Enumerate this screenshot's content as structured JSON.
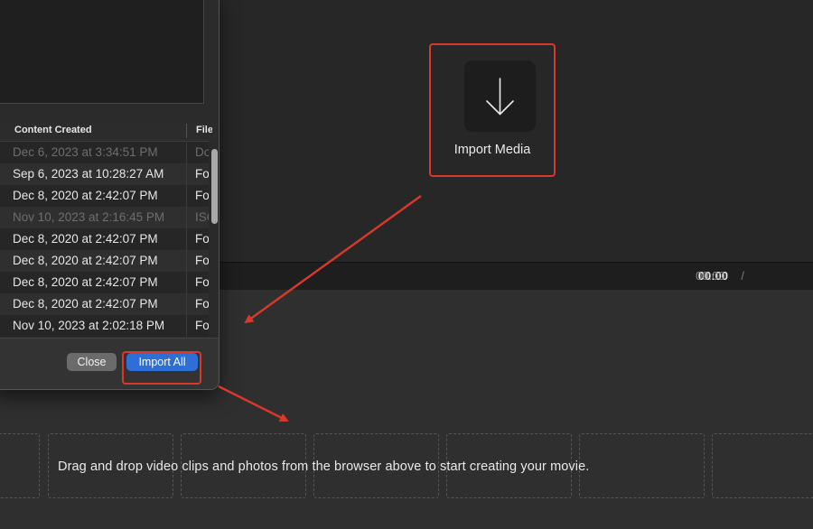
{
  "import_media": {
    "label": "Import Media"
  },
  "transport": {
    "current_time": "00:00",
    "separator": "/",
    "total_time": "00:00"
  },
  "timeline": {
    "hint": "Drag and drop video clips and photos from the browser above to start creating your movie."
  },
  "import_dialog": {
    "columns": [
      "Content Created",
      "File"
    ],
    "rows": [
      {
        "date": "Dec 6, 2023 at 3:34:51 PM",
        "file": "Do",
        "dimmed": true
      },
      {
        "date": "Sep 6, 2023 at 10:28:27 AM",
        "file": "Fo",
        "dimmed": false
      },
      {
        "date": "Dec 8, 2020 at 2:42:07 PM",
        "file": "Fo",
        "dimmed": false
      },
      {
        "date": "Nov 10, 2023 at 2:16:45 PM",
        "file": "ISO",
        "dimmed": true
      },
      {
        "date": "Dec 8, 2020 at 2:42:07 PM",
        "file": "Fo",
        "dimmed": false
      },
      {
        "date": "Dec 8, 2020 at 2:42:07 PM",
        "file": "Fo",
        "dimmed": false
      },
      {
        "date": "Dec 8, 2020 at 2:42:07 PM",
        "file": "Fo",
        "dimmed": false
      },
      {
        "date": "Dec 8, 2020 at 2:42:07 PM",
        "file": "Fo",
        "dimmed": false
      },
      {
        "date": "Nov 10, 2023 at 2:02:18 PM",
        "file": "Fo",
        "dimmed": false
      }
    ],
    "close_label": "Close",
    "import_all_label": "Import All"
  },
  "colors": {
    "highlight": "#d8392b",
    "primary_button": "#2d6fd6",
    "text": "#e6e6e6",
    "dimmed_text": "#6e6e6e"
  },
  "icons": {
    "import": "arrow-down-icon"
  }
}
